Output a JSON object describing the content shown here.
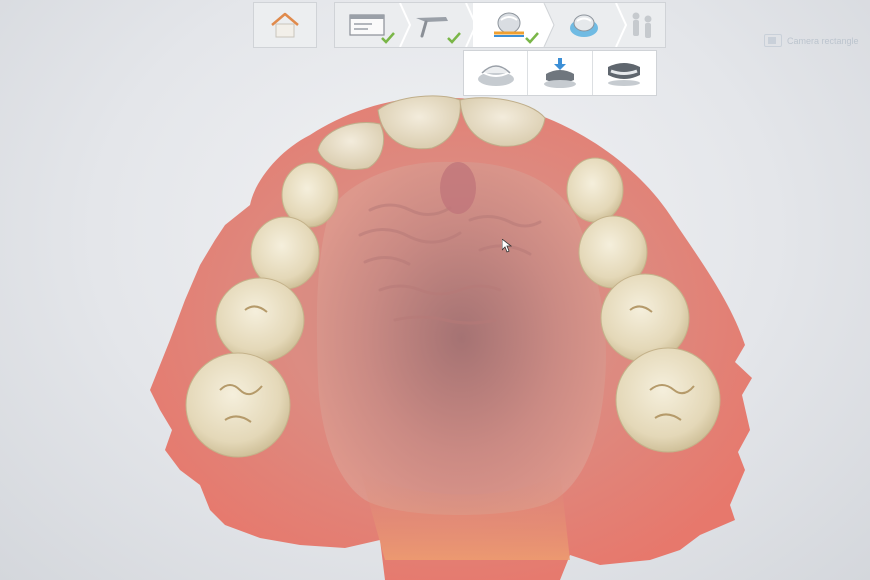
{
  "toolbar": {
    "home": {
      "icon": "home-icon",
      "color": "#e08a4c"
    },
    "steps": [
      {
        "id": "administration",
        "icon": "form-icon",
        "completed": true
      },
      {
        "id": "scan",
        "icon": "scanner-wand-icon",
        "completed": true
      },
      {
        "id": "model",
        "icon": "jaw-model-icon",
        "completed": true,
        "active": true
      },
      {
        "id": "design",
        "icon": "restoration-design-icon",
        "completed": false
      },
      {
        "id": "export",
        "icon": "people-icon",
        "completed": false,
        "disabled": true
      }
    ],
    "check_color": "#7ab648"
  },
  "substeps": [
    {
      "id": "arch-view",
      "icon": "lower-arch-icon"
    },
    {
      "id": "occlusion-view",
      "icon": "bite-alignment-icon"
    },
    {
      "id": "upper-view",
      "icon": "upper-arch-icon"
    }
  ],
  "camera": {
    "label": "Camera rectangle"
  },
  "scene": {
    "subject": "upper-jaw-scan",
    "gum_color": "#e58a80",
    "tooth_color": "#ece3c8"
  }
}
